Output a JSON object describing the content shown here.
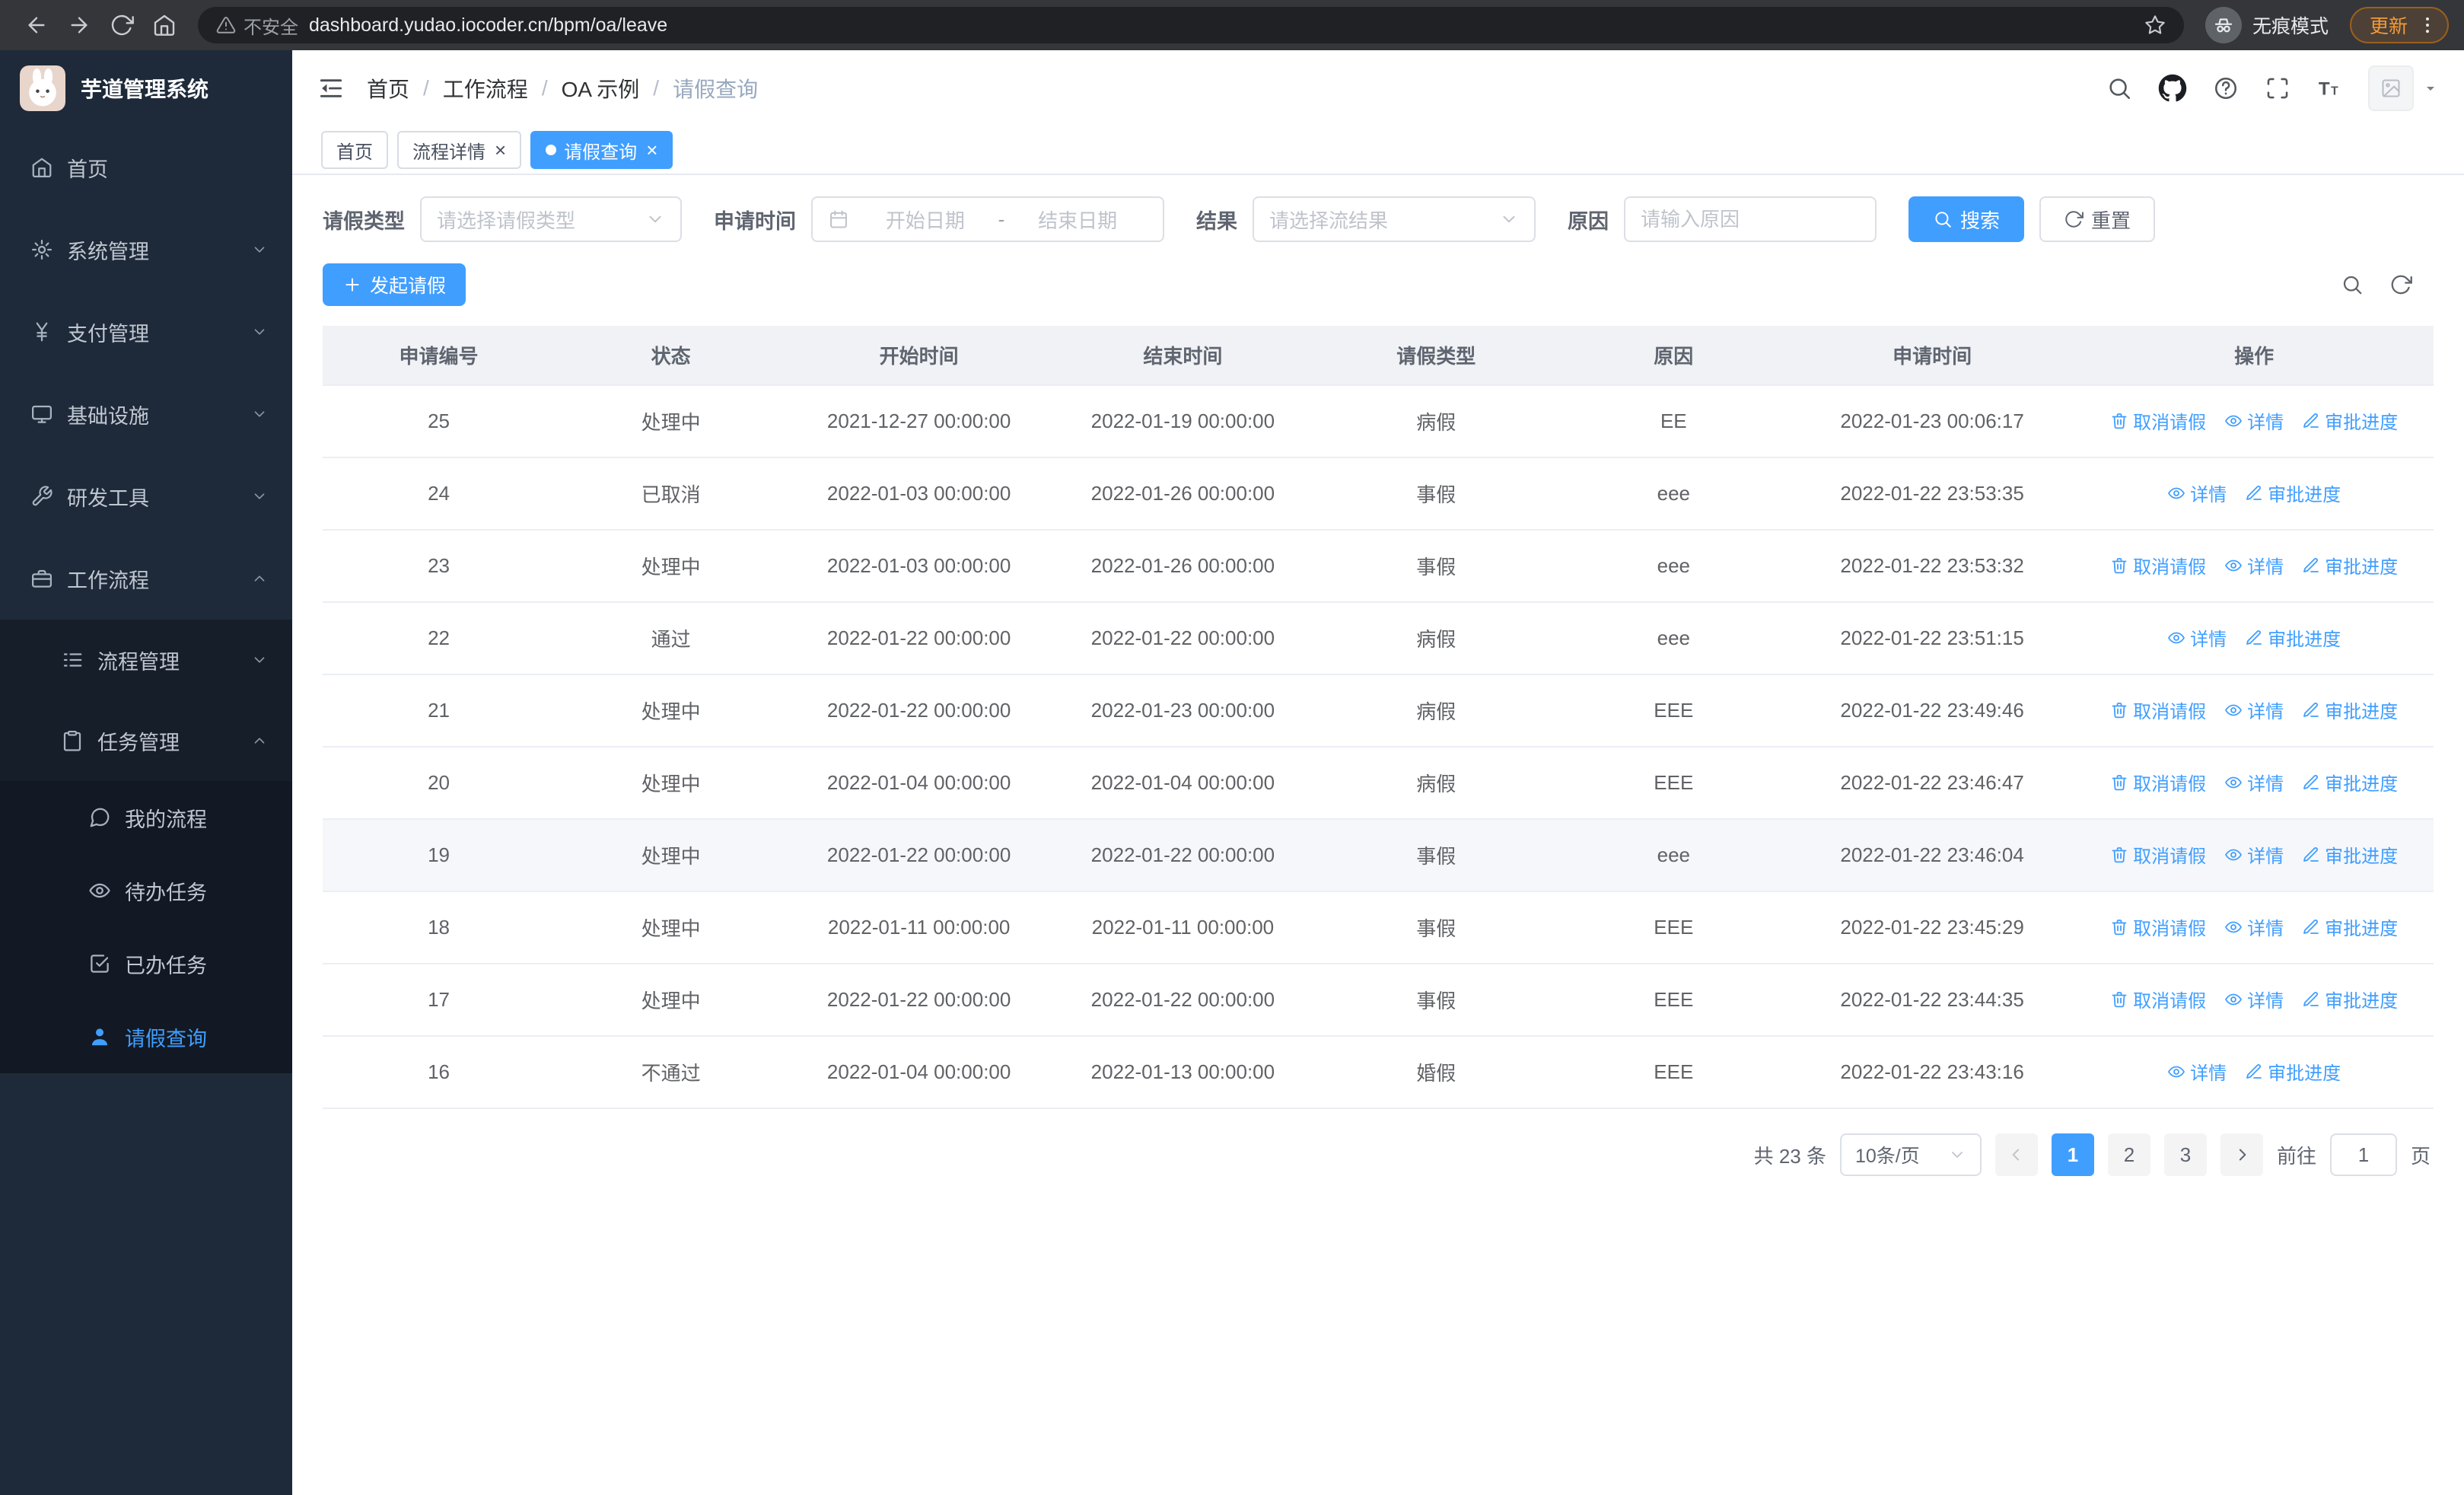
{
  "theme": {
    "primary": "#409eff",
    "sidebar_bg": "#1e2a39",
    "tab_active_bg": "#409eff"
  },
  "browser": {
    "security_warning": "不安全",
    "url": "dashboard.yudao.iocoder.cn/bpm/oa/leave",
    "incognito_label": "无痕模式",
    "update_label": "更新"
  },
  "sidebar": {
    "app_title": "芋道管理系统",
    "items": [
      {
        "key": "home",
        "label": "首页",
        "icon": "home",
        "level": 1,
        "type": "item",
        "expanded": false,
        "active": false
      },
      {
        "key": "system-management",
        "label": "系统管理",
        "icon": "gear",
        "level": 1,
        "type": "submenu",
        "expanded": false,
        "active": false
      },
      {
        "key": "payment-management",
        "label": "支付管理",
        "icon": "yen",
        "level": 1,
        "type": "submenu",
        "expanded": false,
        "active": false
      },
      {
        "key": "infrastructure",
        "label": "基础设施",
        "icon": "monitor",
        "level": 1,
        "type": "submenu",
        "expanded": false,
        "active": false
      },
      {
        "key": "dev-tools",
        "label": "研发工具",
        "icon": "wrench",
        "level": 1,
        "type": "submenu",
        "expanded": false,
        "active": false
      },
      {
        "key": "workflow",
        "label": "工作流程",
        "icon": "briefcase",
        "level": 1,
        "type": "submenu",
        "expanded": true,
        "active": false
      },
      {
        "key": "process-management",
        "label": "流程管理",
        "icon": "list",
        "level": 2,
        "type": "submenu",
        "expanded": false,
        "active": false
      },
      {
        "key": "task-management",
        "label": "任务管理",
        "icon": "clipboard",
        "level": 2,
        "type": "submenu",
        "expanded": true,
        "active": false
      },
      {
        "key": "my-process",
        "label": "我的流程",
        "icon": "message",
        "level": 3,
        "type": "item",
        "expanded": false,
        "active": false
      },
      {
        "key": "todo-tasks",
        "label": "待办任务",
        "icon": "eye",
        "level": 3,
        "type": "item",
        "expanded": false,
        "active": false
      },
      {
        "key": "done-tasks",
        "label": "已办任务",
        "icon": "check-square",
        "level": 3,
        "type": "item",
        "expanded": false,
        "active": false
      },
      {
        "key": "leave-query",
        "label": "请假查询",
        "icon": "user",
        "level": 3,
        "type": "item",
        "expanded": false,
        "active": true
      }
    ]
  },
  "header": {
    "breadcrumb": [
      "首页",
      "工作流程",
      "OA 示例",
      "请假查询"
    ]
  },
  "tabs": [
    {
      "key": "home",
      "label": "首页",
      "closable": false,
      "active": false
    },
    {
      "key": "process-detail",
      "label": "流程详情",
      "closable": true,
      "active": false
    },
    {
      "key": "leave-query",
      "label": "请假查询",
      "closable": true,
      "active": true
    }
  ],
  "filters": {
    "leave_type_label": "请假类型",
    "leave_type_placeholder": "请选择请假类型",
    "apply_time_label": "申请时间",
    "start_date_placeholder": "开始日期",
    "range_separator": "-",
    "end_date_placeholder": "结束日期",
    "result_label": "结果",
    "result_placeholder": "请选择流结果",
    "reason_label": "原因",
    "reason_placeholder": "请输入原因",
    "search_button": "搜索",
    "reset_button": "重置"
  },
  "toolbar": {
    "create_button": "发起请假"
  },
  "table": {
    "columns": [
      "申请编号",
      "状态",
      "开始时间",
      "结束时间",
      "请假类型",
      "原因",
      "申请时间",
      "操作"
    ],
    "action_labels": {
      "cancel": "取消请假",
      "detail": "详情",
      "progress": "审批进度"
    },
    "rows": [
      {
        "id": "25",
        "status": "处理中",
        "start_time": "2021-12-27 00:00:00",
        "end_time": "2022-01-19 00:00:00",
        "leave_type": "病假",
        "reason": "EE",
        "apply_time": "2022-01-23 00:06:17",
        "actions": [
          "cancel",
          "detail",
          "progress"
        ],
        "highlighted": false
      },
      {
        "id": "24",
        "status": "已取消",
        "start_time": "2022-01-03 00:00:00",
        "end_time": "2022-01-26 00:00:00",
        "leave_type": "事假",
        "reason": "eee",
        "apply_time": "2022-01-22 23:53:35",
        "actions": [
          "detail",
          "progress"
        ],
        "highlighted": false
      },
      {
        "id": "23",
        "status": "处理中",
        "start_time": "2022-01-03 00:00:00",
        "end_time": "2022-01-26 00:00:00",
        "leave_type": "事假",
        "reason": "eee",
        "apply_time": "2022-01-22 23:53:32",
        "actions": [
          "cancel",
          "detail",
          "progress"
        ],
        "highlighted": false
      },
      {
        "id": "22",
        "status": "通过",
        "start_time": "2022-01-22 00:00:00",
        "end_time": "2022-01-22 00:00:00",
        "leave_type": "病假",
        "reason": "eee",
        "apply_time": "2022-01-22 23:51:15",
        "actions": [
          "detail",
          "progress"
        ],
        "highlighted": false
      },
      {
        "id": "21",
        "status": "处理中",
        "start_time": "2022-01-22 00:00:00",
        "end_time": "2022-01-23 00:00:00",
        "leave_type": "病假",
        "reason": "EEE",
        "apply_time": "2022-01-22 23:49:46",
        "actions": [
          "cancel",
          "detail",
          "progress"
        ],
        "highlighted": false
      },
      {
        "id": "20",
        "status": "处理中",
        "start_time": "2022-01-04 00:00:00",
        "end_time": "2022-01-04 00:00:00",
        "leave_type": "病假",
        "reason": "EEE",
        "apply_time": "2022-01-22 23:46:47",
        "actions": [
          "cancel",
          "detail",
          "progress"
        ],
        "highlighted": false
      },
      {
        "id": "19",
        "status": "处理中",
        "start_time": "2022-01-22 00:00:00",
        "end_time": "2022-01-22 00:00:00",
        "leave_type": "事假",
        "reason": "eee",
        "apply_time": "2022-01-22 23:46:04",
        "actions": [
          "cancel",
          "detail",
          "progress"
        ],
        "highlighted": true
      },
      {
        "id": "18",
        "status": "处理中",
        "start_time": "2022-01-11 00:00:00",
        "end_time": "2022-01-11 00:00:00",
        "leave_type": "事假",
        "reason": "EEE",
        "apply_time": "2022-01-22 23:45:29",
        "actions": [
          "cancel",
          "detail",
          "progress"
        ],
        "highlighted": false
      },
      {
        "id": "17",
        "status": "处理中",
        "start_time": "2022-01-22 00:00:00",
        "end_time": "2022-01-22 00:00:00",
        "leave_type": "事假",
        "reason": "EEE",
        "apply_time": "2022-01-22 23:44:35",
        "actions": [
          "cancel",
          "detail",
          "progress"
        ],
        "highlighted": false
      },
      {
        "id": "16",
        "status": "不通过",
        "start_time": "2022-01-04 00:00:00",
        "end_time": "2022-01-13 00:00:00",
        "leave_type": "婚假",
        "reason": "EEE",
        "apply_time": "2022-01-22 23:43:16",
        "actions": [
          "detail",
          "progress"
        ],
        "highlighted": false
      }
    ]
  },
  "pagination": {
    "total_text": "共 23 条",
    "page_size": "10条/页",
    "pages": [
      "1",
      "2",
      "3"
    ],
    "active_page": "1",
    "goto_label": "前往",
    "goto_value": "1",
    "page_suffix": "页"
  }
}
